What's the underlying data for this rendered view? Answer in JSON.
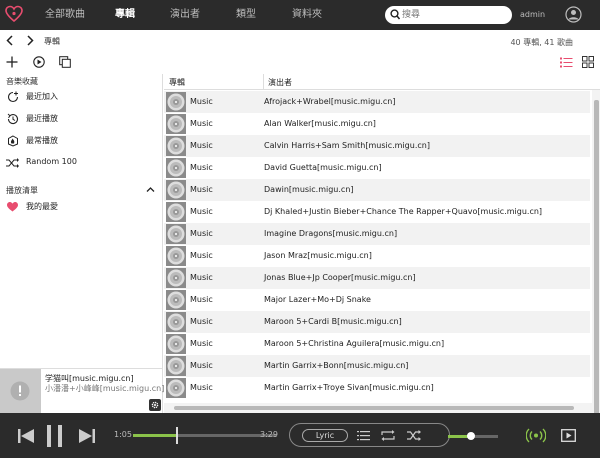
{
  "nav": {
    "items": [
      {
        "label": "全部歌曲",
        "active": false
      },
      {
        "label": "專輯",
        "active": true
      },
      {
        "label": "演出者",
        "active": false
      },
      {
        "label": "類型",
        "active": false
      },
      {
        "label": "資料夾",
        "active": false
      }
    ],
    "search": {
      "value": "",
      "placeholder": "搜尋"
    },
    "user": "admin"
  },
  "toolbar": {
    "breadcrumb": "專輯",
    "count": "40 專輯, 41 歌曲"
  },
  "sidebar": {
    "library_title": "音樂收藏",
    "library_items": [
      {
        "label": "最近加入",
        "icon": "recently-added-icon"
      },
      {
        "label": "最近播放",
        "icon": "recently-played-icon"
      },
      {
        "label": "最常播放",
        "icon": "most-played-icon"
      },
      {
        "label": "Random 100",
        "icon": "shuffle-icon"
      }
    ],
    "playlist_title": "播放清單",
    "playlists": [
      {
        "label": "我的最愛",
        "icon": "heart-icon"
      }
    ]
  },
  "list": {
    "headers": {
      "album": "專輯",
      "artist": "演出者"
    },
    "rows": [
      {
        "album": "Music",
        "artist": "Afrojack+Wrabel[music.migu.cn]"
      },
      {
        "album": "Music",
        "artist": "Alan Walker[music.migu.cn]"
      },
      {
        "album": "Music",
        "artist": "Calvin Harris+Sam Smith[music.migu.cn]"
      },
      {
        "album": "Music",
        "artist": "David Guetta[music.migu.cn]"
      },
      {
        "album": "Music",
        "artist": "Dawin[music.migu.cn]"
      },
      {
        "album": "Music",
        "artist": "Dj Khaled+Justin Bieber+Chance The Rapper+Quavo[music.migu.cn]"
      },
      {
        "album": "Music",
        "artist": "Imagine Dragons[music.migu.cn]"
      },
      {
        "album": "Music",
        "artist": "Jason Mraz[music.migu.cn]"
      },
      {
        "album": "Music",
        "artist": "Jonas Blue+Jp Cooper[music.migu.cn]"
      },
      {
        "album": "Music",
        "artist": "Major Lazer+Mo+Dj Snake"
      },
      {
        "album": "Music",
        "artist": "Maroon 5+Cardi B[music.migu.cn]"
      },
      {
        "album": "Music",
        "artist": "Maroon 5+Christina Aguilera[music.migu.cn]"
      },
      {
        "album": "Music",
        "artist": "Martin Garrix+Bonn[music.migu.cn]"
      },
      {
        "album": "Music",
        "artist": "Martin Garrix+Troye Sivan[music.migu.cn]"
      }
    ]
  },
  "now_playing": {
    "title": "学猫叫[music.migu.cn]",
    "artist": "小潘潘+小峰峰[music.migu.cn]"
  },
  "player": {
    "elapsed": "1:05",
    "duration": "3:29",
    "progress_fraction": 0.31,
    "lyric_label": "Lyric",
    "volume_fraction": 0.45
  },
  "colors": {
    "topbar": "#2b2b2b",
    "accent": "#8bc34a",
    "logo": "#e84d6f",
    "heart": "#e84d6f"
  }
}
